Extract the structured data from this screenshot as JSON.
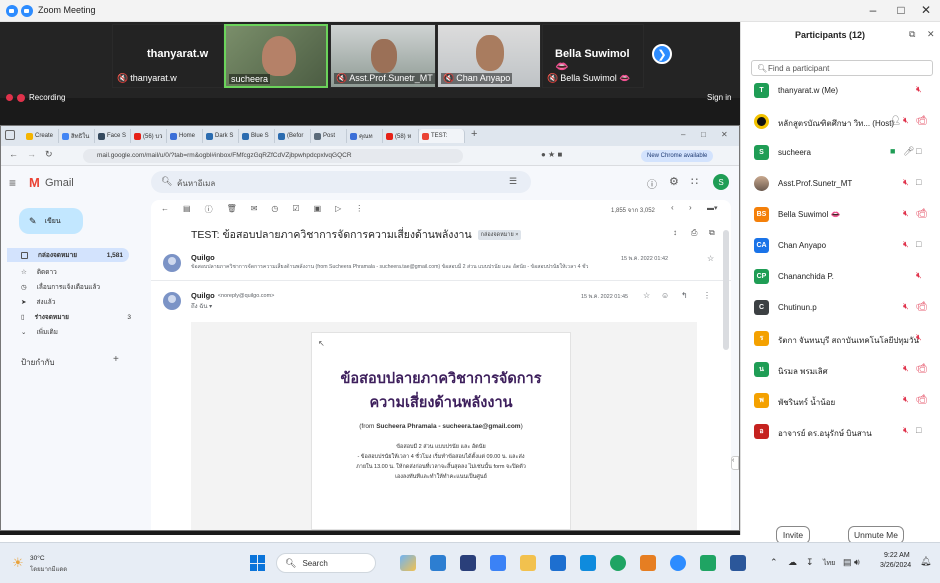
{
  "window": {
    "title": "Zoom Meeting",
    "minimize": "–",
    "restore": "□",
    "close": "✕"
  },
  "meeting": {
    "tiles": [
      {
        "display": "thanyarat.w",
        "label": "thanyarat.w"
      },
      {
        "label": "sucheera"
      },
      {
        "label": "Asst.Prof.Sunetr_MT"
      },
      {
        "label": "Chan Anyapo"
      },
      {
        "display": "Bella Suwimol 👄",
        "label": "Bella Suwimol 👄"
      }
    ],
    "recording": "Recording",
    "signin": "Sign in"
  },
  "browser": {
    "tabs": [
      "Create",
      "สิทธิใน",
      "Face S",
      "(56) บว",
      "Home",
      "Dark S",
      "Blue S",
      "(Befor",
      "Post",
      "คุณท",
      "(58) ห",
      "TEST:"
    ],
    "url": "mail.google.com/mail/u/0/?tab=rm&ogbl#inbox/FMfcgzGqRZfCdVZjbpwhpdcpxlvqGQCR",
    "new_chrome": "New Chrome available"
  },
  "gmail": {
    "brand": "Gmail",
    "search_placeholder": "ค้นหาอีเมล",
    "avatar_letter": "S",
    "compose": "เขียน",
    "nav": [
      {
        "label": "กล่องจดหมาย",
        "count": "1,581"
      },
      {
        "label": "ติดดาว",
        "count": ""
      },
      {
        "label": "เลื่อนการแจ้งเตือนแล้ว",
        "count": ""
      },
      {
        "label": "ส่งแล้ว",
        "count": ""
      },
      {
        "label": "ร่างจดหมาย",
        "count": "3"
      },
      {
        "label": "เพิ่มเติม",
        "count": ""
      }
    ],
    "labels_heading": "ป้ายกำกับ",
    "pagination": "1,855 จาก 3,052",
    "subject": "TEST: ข้อสอบปลายภาควิชาการจัดการความเสี่ยงด้านพลังงาน",
    "subject_tag": "กล่องจดหมาย ×",
    "msg1": {
      "sender": "Quilgo",
      "snippet": "ข้อสอบปลายภาควิชาการจัดการความเสี่ยงด้านพลังงาน (from Sucheera Phramala - sucheera.tae@gmail.com) ข้อสอบมี 2 ส่วน แบบปรนัย และ อัตนัย - ข้อสอบปรนัยให้เวลา 4 ชั่ว",
      "date": "15 พ.ค. 2022 01:42"
    },
    "msg2": {
      "sender": "Quilgo",
      "email": "<noreply@quilgo.com>",
      "to": "ถึง ฉัน ▾",
      "date": "15 พ.ค. 2022 01:45"
    },
    "doc": {
      "title1": "ข้อสอบปลายภาควิชาการจัดการ",
      "title2": "ความเสี่ยงด้านพลังงาน",
      "from_prefix": "(from ",
      "from_name": "Sucheera Phramala - sucheera.tae@gmail.com",
      "from_suffix": ")",
      "line1": "ข้อสอบมี 2 ส่วน แบบปรนัย และ อัตนัย",
      "line2": "- ข้อสอบปรนัยให้เวลา 4 ชั่วโมง เริ่มทำข้อสอบได้ตั้งแต่ 09.00 น. และส่ง",
      "line3": "ภายใน 13.00 น. ให้กดส่งก่อนที่เวลาจะสิ้นสุดลง ไม่เช่นนั้น form จะปิดตัว",
      "line4": "เองลงทันทีและทำให้ทำคะแนนเป็นศูนย์"
    }
  },
  "participants": {
    "title": "Participants (12)",
    "search_placeholder": "Find a participant",
    "list": [
      {
        "initials": "T",
        "color": "#1f9d55",
        "name": "thanyarat.w (Me)"
      },
      {
        "initials": "",
        "color": "#111111",
        "name": "หลักสูตรบัณฑิตศึกษา วิท... (Host)"
      },
      {
        "initials": "S",
        "color": "#1f9d55",
        "name": "sucheera"
      },
      {
        "initials": "",
        "color": "#9aa0a6",
        "name": "Asst.Prof.Sunetr_MT"
      },
      {
        "initials": "BS",
        "color": "#f4800a",
        "name": "Bella Suwimol 👄"
      },
      {
        "initials": "CA",
        "color": "#1a73e8",
        "name": "Chan Anyapo"
      },
      {
        "initials": "CP",
        "color": "#1f9d55",
        "name": "Chananchida P."
      },
      {
        "initials": "C",
        "color": "#3c4043",
        "name": "Chutinun.p"
      },
      {
        "initials": "ร",
        "color": "#f4a100",
        "name": "รัตกา จันทนบุรี สถาบันเทคโนโลยีปทุมวัน"
      },
      {
        "initials": "น",
        "color": "#1f9d55",
        "name": "นิรมล พรมเลิศ"
      },
      {
        "initials": "พ",
        "color": "#f4a100",
        "name": "พัชรินทร์ น้ำน้อย"
      },
      {
        "initials": "อ",
        "color": "#c5221f",
        "name": "อาจารย์ ดร.อนุรักษ์ บินสาน"
      }
    ],
    "invite": "Invite",
    "unmute": "Unmute Me"
  },
  "taskbar": {
    "weather_temp": "30°C",
    "weather_desc": "โดยมากมีแดด",
    "search": "Search",
    "lang": "ไทย",
    "time": "9:22 AM",
    "date": "3/26/2024"
  },
  "colors": {
    "zoom_blue": "#2d8cff",
    "mic_red": "#e0324b",
    "doc_purple": "#3d1f5c"
  }
}
